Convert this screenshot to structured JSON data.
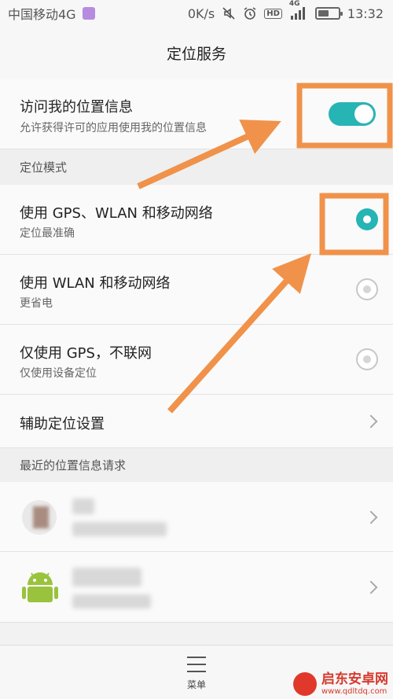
{
  "status_bar": {
    "carrier": "中国移动4G",
    "speed": "0K/s",
    "hd": "HD",
    "net": "4G",
    "time": "13:32",
    "battery_level": 0.55
  },
  "title": "定位服务",
  "access": {
    "title": "访问我的位置信息",
    "subtitle": "允许获得许可的应用使用我的位置信息",
    "enabled": true
  },
  "mode_section": "定位模式",
  "modes": [
    {
      "title": "使用 GPS、WLAN 和移动网络",
      "subtitle": "定位最准确",
      "selected": true
    },
    {
      "title": "使用 WLAN 和移动网络",
      "subtitle": "更省电",
      "selected": false
    },
    {
      "title": "仅使用 GPS，不联网",
      "subtitle": "仅使用设备定位",
      "selected": false
    }
  ],
  "assist": "辅助定位设置",
  "recent_section": "最近的位置信息请求",
  "menu_label": "菜单",
  "watermark": {
    "title": "启东安卓网",
    "url": "www.qdltdq.com"
  },
  "colors": {
    "accent": "#27b4b4",
    "annotation": "#f0924a"
  },
  "icons": [
    "photo-icon",
    "mute-icon",
    "alarm-icon",
    "signal-icon",
    "battery-icon",
    "chevron-right-icon",
    "menu-icon",
    "android-icon"
  ]
}
